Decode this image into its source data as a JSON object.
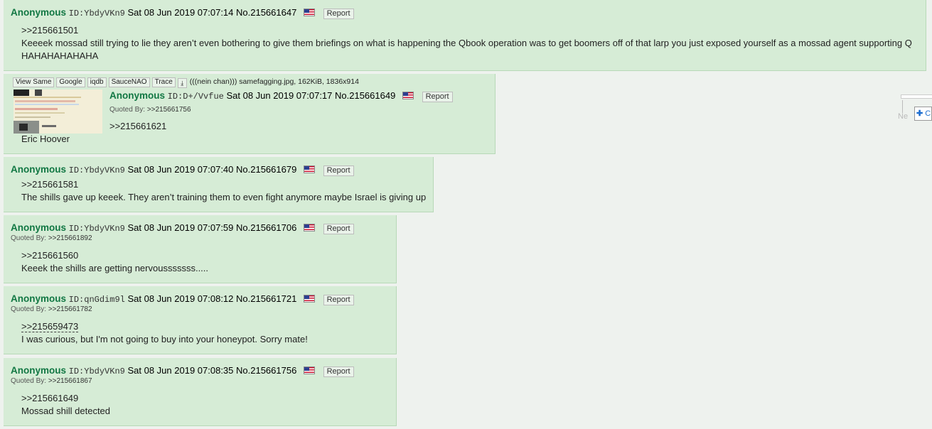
{
  "posts": [
    {
      "name": "Anonymous",
      "uid": "ID:YbdyVKn9",
      "datetime": "Sat 08 Jun 2019 07:07:14",
      "no": "No.215661647",
      "report": "Report",
      "quote": ">>215661501",
      "lines": [
        "Keeeek mossad still trying to lie they aren’t even bothering to give them briefings on what is happening the Qbook operation was to get boomers off of that larp you just exposed yourself as a mossad agent supporting Q",
        "HAHAHAHAHAHA"
      ]
    },
    {
      "file": {
        "buttons": [
          "View Same",
          "Google",
          "iqdb",
          "SauceNAO",
          "Trace"
        ],
        "info": "(((nein chan))) samefagging.jpg, 162KiB, 1836x914"
      },
      "name": "Anonymous",
      "uid": "ID:D+/Vvfue",
      "datetime": "Sat 08 Jun 2019 07:07:17",
      "no": "No.215661649",
      "report": "Report",
      "quoted_by_label": "Quoted By:",
      "quoted_by": ">>215661756",
      "quote": ">>215661621",
      "lines": [
        "Eric Hoover"
      ]
    },
    {
      "name": "Anonymous",
      "uid": "ID:YbdyVKn9",
      "datetime": "Sat 08 Jun 2019 07:07:40",
      "no": "No.215661679",
      "report": "Report",
      "quote": ">>215661581",
      "lines": [
        "The shills gave up keeek. They aren’t training them to even fight anymore maybe Israel is giving up"
      ]
    },
    {
      "name": "Anonymous",
      "uid": "ID:YbdyVKn9",
      "datetime": "Sat 08 Jun 2019 07:07:59",
      "no": "No.215661706",
      "report": "Report",
      "quoted_by_label": "Quoted By:",
      "quoted_by": ">>215661892",
      "quote": ">>215661560",
      "lines": [
        "Keeek the shills are getting nervousssssss....."
      ]
    },
    {
      "name": "Anonymous",
      "uid": "ID:qnGdim9l",
      "datetime": "Sat 08 Jun 2019 07:08:12",
      "no": "No.215661721",
      "report": "Report",
      "quoted_by_label": "Quoted By:",
      "quoted_by": ">>215661782",
      "quote": ">>215659473",
      "lines": [
        "I was curious, but I'm not going to buy into your honeypot. Sorry mate!"
      ]
    },
    {
      "name": "Anonymous",
      "uid": "ID:YbdyVKn9",
      "datetime": "Sat 08 Jun 2019 07:08:35",
      "no": "No.215661756",
      "report": "Report",
      "quoted_by_label": "Quoted By:",
      "quoted_by": ">>215661867",
      "quote": ">>215661649",
      "lines": [
        "Mossad shill detected"
      ]
    }
  ],
  "side_widget": {
    "label_fragment": "Ne",
    "button_fragment": "C",
    "icon": "plus-icon"
  },
  "colors": {
    "reply_bg": "#d6ecd6",
    "name": "#117743",
    "page_bg": "#eef2ee"
  }
}
